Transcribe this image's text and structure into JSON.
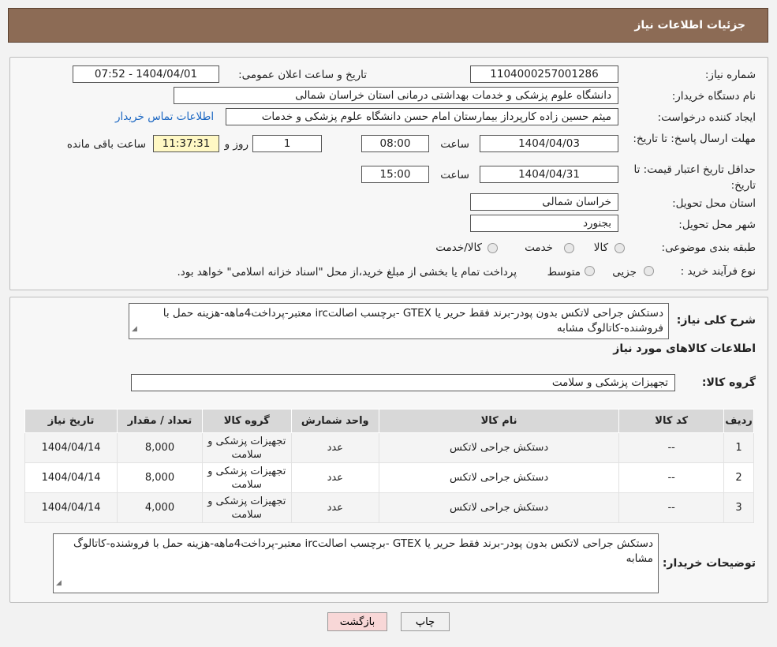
{
  "header": {
    "title": "جزئیات اطلاعات نیاز"
  },
  "form": {
    "need_number_label": "شماره نیاز:",
    "need_number": "1104000257001286",
    "announce_label": "تاریخ و ساعت اعلان عمومی:",
    "announce_value": "1404/04/01 - 07:52",
    "buyer_org_label": "نام دستگاه خریدار:",
    "buyer_org": "دانشگاه علوم پزشکی و خدمات بهداشتی درمانی استان خراسان شمالی",
    "requester_label": "ایجاد کننده درخواست:",
    "requester": "میثم  حسین زاده  کارپرداز بیمارستان امام حسن دانشگاه علوم پزشکی و خدمات",
    "contact_link": "اطلاعات تماس خریدار",
    "deadline_label": "مهلت ارسال پاسخ: تا تاریخ:",
    "deadline_date": "1404/04/03",
    "time_label": "ساعت",
    "deadline_time": "08:00",
    "days_value": "1",
    "days_label": "روز و",
    "remaining_time": "11:37:31",
    "remaining_label": "ساعت باقی مانده",
    "price_validity_label": "حداقل تاریخ اعتبار قیمت: تا تاریخ:",
    "price_validity_date": "1404/04/31",
    "price_validity_time": "15:00",
    "province_label": "استان محل تحویل:",
    "province": "خراسان شمالی",
    "city_label": "شهر محل تحویل:",
    "city": "بجنورد",
    "category_label": "طبقه بندی موضوعی:",
    "category_options": [
      "کالا",
      "خدمت",
      "کالا/خدمت"
    ],
    "purchase_type_label": "نوع فرآیند خرید :",
    "purchase_options": [
      "جزیی",
      "متوسط"
    ],
    "purchase_note": "پرداخت تمام یا بخشی از مبلغ خرید،از محل \"اسناد خزانه اسلامی\" خواهد بود."
  },
  "details": {
    "summary_label": "شرح کلی نیاز:",
    "summary_text": "دستکش جراحی لاتکس بدون پودر-برند فقط حریر یا GTEX -برچسب اصالتirc معتبر-پرداخت4ماهه-هزینه حمل با فروشنده-کاتالوگ مشابه",
    "items_title": "اطلاعات کالاهای مورد نیاز",
    "group_label": "گروه کالا:",
    "group_value": "تجهیزات پزشکی و سلامت",
    "columns": [
      "ردیف",
      "کد کالا",
      "نام کالا",
      "واحد شمارش",
      "گروه کالا",
      "تعداد / مقدار",
      "تاریخ نیاز"
    ],
    "rows": [
      [
        "1",
        "--",
        "دستکش جراحی لاتکس",
        "عدد",
        "تجهیزات پزشکی و سلامت",
        "8,000",
        "1404/04/14"
      ],
      [
        "2",
        "--",
        "دستکش جراحی لاتکس",
        "عدد",
        "تجهیزات پزشکی و سلامت",
        "8,000",
        "1404/04/14"
      ],
      [
        "3",
        "--",
        "دستکش جراحی لاتکس",
        "عدد",
        "تجهیزات پزشکی و سلامت",
        "4,000",
        "1404/04/14"
      ]
    ],
    "buyer_notes_label": "توضیحات خریدار:",
    "buyer_notes_text": "دستکش جراحی لاتکس بدون پودر-برند فقط حریر یا GTEX -برچسب اصالتirc معتبر-پرداخت4ماهه-هزینه حمل با فروشنده-کاتالوگ مشابه"
  },
  "buttons": {
    "print": "چاپ",
    "back": "بازگشت"
  },
  "colors": {
    "header_bg": "#8c6b55",
    "link": "#1a66c2",
    "back_button_bg": "#f8d7d7"
  }
}
